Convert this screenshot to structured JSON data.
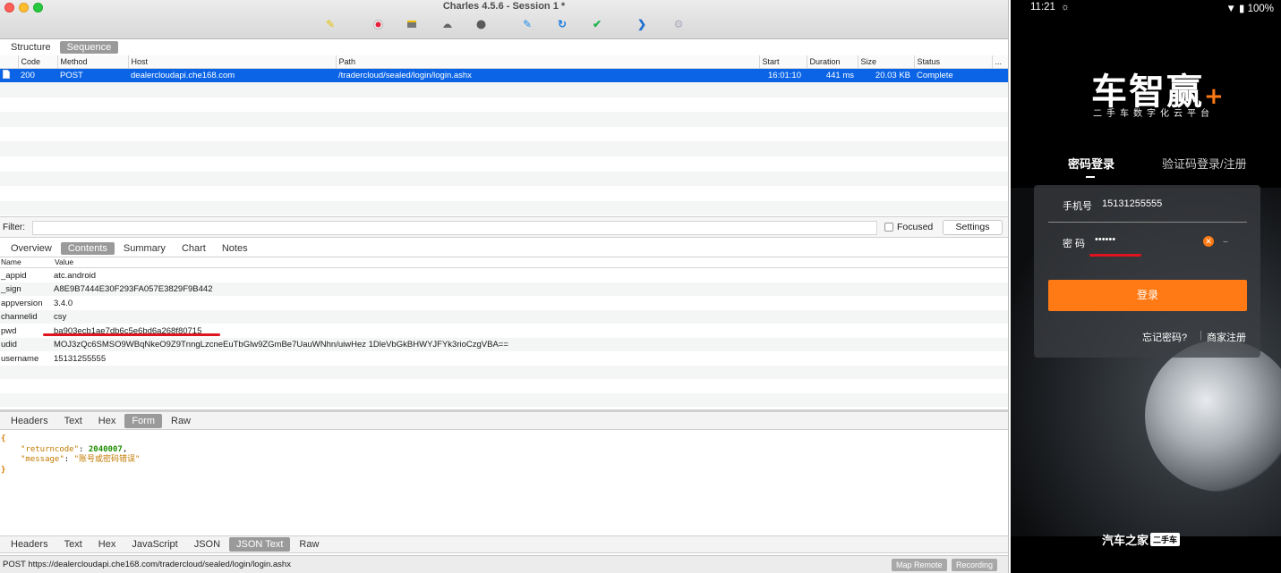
{
  "charles": {
    "window_title": "Charles 4.5.6 - Session 1 *",
    "view_tabs": [
      "Structure",
      "Sequence"
    ],
    "sequence": {
      "columns": [
        "Code",
        "Method",
        "Host",
        "Path",
        "Start",
        "Duration",
        "Size",
        "Status",
        "..."
      ],
      "rows": [
        {
          "code": "200",
          "method": "POST",
          "host": "dealercloudapi.che168.com",
          "path": "/tradercloud/sealed/login/login.ashx",
          "start": "16:01:10",
          "duration": "441 ms",
          "size": "20.03 KB",
          "status": "Complete"
        }
      ]
    },
    "filter": {
      "label": "Filter:",
      "focused_label": "Focused",
      "settings_label": "Settings"
    },
    "detail_tabs": [
      "Overview",
      "Contents",
      "Summary",
      "Chart",
      "Notes"
    ],
    "request": {
      "columns": [
        "Name",
        "Value"
      ],
      "rows": [
        {
          "name": "_appid",
          "value": "atc.android"
        },
        {
          "name": "_sign",
          "value": "A8E9B7444E30F293FA057E3829F9B442"
        },
        {
          "name": "appversion",
          "value": "3.4.0"
        },
        {
          "name": "channelid",
          "value": "csy"
        },
        {
          "name": "pwd",
          "value": "ba903ecb1ae7db6c5e6bd6a268f80715"
        },
        {
          "name": "udid",
          "value": "MOJ3zQc6SMSO9WBqNkeO9Z9TnngLzcneEuTbGlw9ZGmBe7UauWNhn/uiwHez 1DleVbGkBHWYJFYk3rioCzgVBA=="
        },
        {
          "name": "username",
          "value": "15131255555"
        }
      ]
    },
    "request_tabs": [
      "Headers",
      "Text",
      "Hex",
      "Form",
      "Raw"
    ],
    "response": {
      "open_brace": "{",
      "close_brace": "}",
      "returncode_key": "\"returncode\"",
      "returncode_value": "2040007",
      "message_key": "\"message\"",
      "message_value": "\"账号或密码错误\""
    },
    "response_tabs": [
      "Headers",
      "Text",
      "Hex",
      "JavaScript",
      "JSON",
      "JSON Text",
      "Raw"
    ],
    "status_text": "POST https://dealercloudapi.che168.com/tradercloud/sealed/login/login.ashx",
    "map_remote_label": "Map Remote",
    "recording_label": "Recording",
    "toolbar_icons": [
      "broom-icon",
      "record-icon",
      "throttle-icon",
      "turtle-icon",
      "stop-icon",
      "pen-icon",
      "refresh-icon",
      "check-icon",
      "arrow-icon",
      "gear-icon"
    ],
    "colors": {
      "selection": "#0b64e6",
      "annotation": "#e0141e"
    }
  },
  "phone": {
    "time": "11:21",
    "battery": "100%",
    "logo": "车智赢",
    "logo_plus": "+",
    "slogan": "二手车数字化云平台",
    "tab_password": "密码登录",
    "tab_sms": "验证码登录/注册",
    "phone_label": "手机号",
    "phone_value": "15131255555",
    "pwd_label": "密 码",
    "pwd_value": "••••••",
    "login_button": "登录",
    "forgot_link": "忘记密码?",
    "register_link": "商家注册",
    "brand": "汽车之家",
    "brand_tag": "二手车",
    "accent": "#ff7a14"
  }
}
